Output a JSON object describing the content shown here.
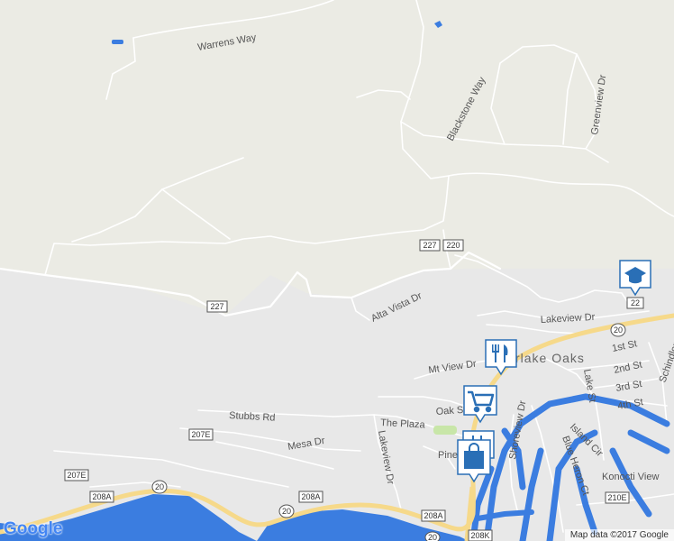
{
  "map": {
    "street_labels": {
      "warrens_way": "Warrens Way",
      "blackstone_way": "Blackstone Way",
      "greenview_dr": "Greenview Dr",
      "alta_vista_dr": "Alta Vista Dr",
      "lakeview_dr_north": "Lakeview Dr",
      "mt_view_dr": "Mt View Dr",
      "oak_st": "Oak St",
      "the_plaza": "The Plaza",
      "stubbs_rd": "Stubbs Rd",
      "mesa_dr": "Mesa Dr",
      "lakeview_dr_south": "Lakeview Dr",
      "pine": "Pine",
      "shoreview_dr": "Shoreview Dr",
      "island_cir": "Island Cir",
      "blue_heron_ct": "Blue Heron Ct",
      "konocti_view": "Konocti View",
      "lake_st": "Lake St",
      "first_st": "1st St",
      "second_st": "2nd St",
      "third_st": "3rd St",
      "fourth_st": "4th St",
      "schindler_st": "Schindler St",
      "town": "rlake Oaks"
    },
    "route_shields": {
      "r227_top": "227",
      "r220": "220",
      "r227_left": "227",
      "r22_right": "22",
      "r20_right": "20",
      "r207E": "207E",
      "r207E_left": "207E",
      "r208A_left": "208A",
      "r20_left": "20",
      "r20_mid": "20",
      "r208A_mid": "208A",
      "r208A_bottom": "208A",
      "r208K": "208K",
      "r20_bottom": "20",
      "r210E": "210E"
    },
    "poi_icons": [
      "school-icon",
      "restaurant-icon",
      "shopping-cart-icon",
      "restaurant-icon",
      "shopping-bag-icon"
    ],
    "colors": {
      "land": "#e8e8e8",
      "hill": "#ebebe4",
      "water": "#3b7de0",
      "road": "#ffffff",
      "highway": "#f6d98a",
      "park": "#c8e6a8",
      "pin": "#2a6fb6"
    }
  },
  "footer": {
    "attribution": "Map data ©2017 Google",
    "logo": "Google"
  }
}
